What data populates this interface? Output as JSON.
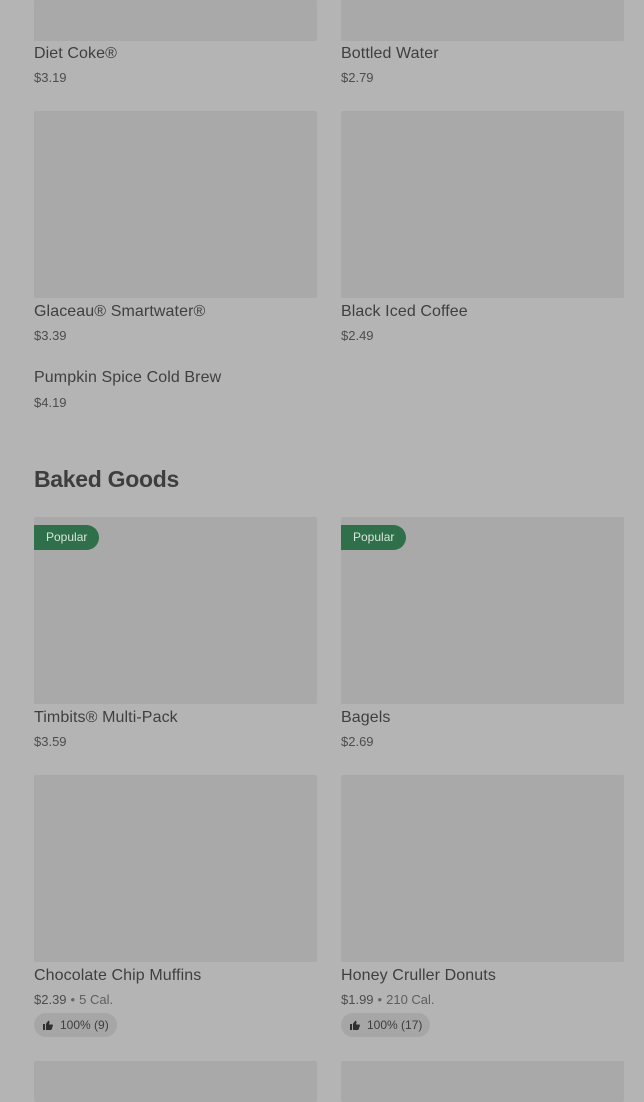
{
  "drinks": [
    {
      "name": "Diet Coke®",
      "price": "$3.19"
    },
    {
      "name": "Bottled Water",
      "price": "$2.79"
    },
    {
      "name": "Glaceau® Smartwater®",
      "price": "$3.39"
    },
    {
      "name": "Black Iced Coffee",
      "price": "$2.49"
    },
    {
      "name": "Pumpkin Spice Cold Brew",
      "price": "$4.19"
    }
  ],
  "baked_goods": {
    "section_title": "Baked Goods",
    "items": [
      {
        "name": "Timbits® Multi-Pack",
        "price": "$3.59",
        "badge": "Popular"
      },
      {
        "name": "Bagels",
        "price": "$2.69",
        "badge": "Popular"
      },
      {
        "name": "Chocolate Chip Muffins",
        "price": "$2.39",
        "separator": "•",
        "calories": "5 Cal.",
        "rating": "100% (9)",
        "rating_icon": "thumbs-up-icon"
      },
      {
        "name": "Honey Cruller Donuts",
        "price": "$1.99",
        "separator": "•",
        "calories": "210 Cal.",
        "rating": "100% (17)",
        "rating_icon": "thumbs-up-icon"
      }
    ]
  },
  "colors": {
    "overlay_background": "#b4b4b4",
    "badge_green": "#2f6f4a"
  }
}
